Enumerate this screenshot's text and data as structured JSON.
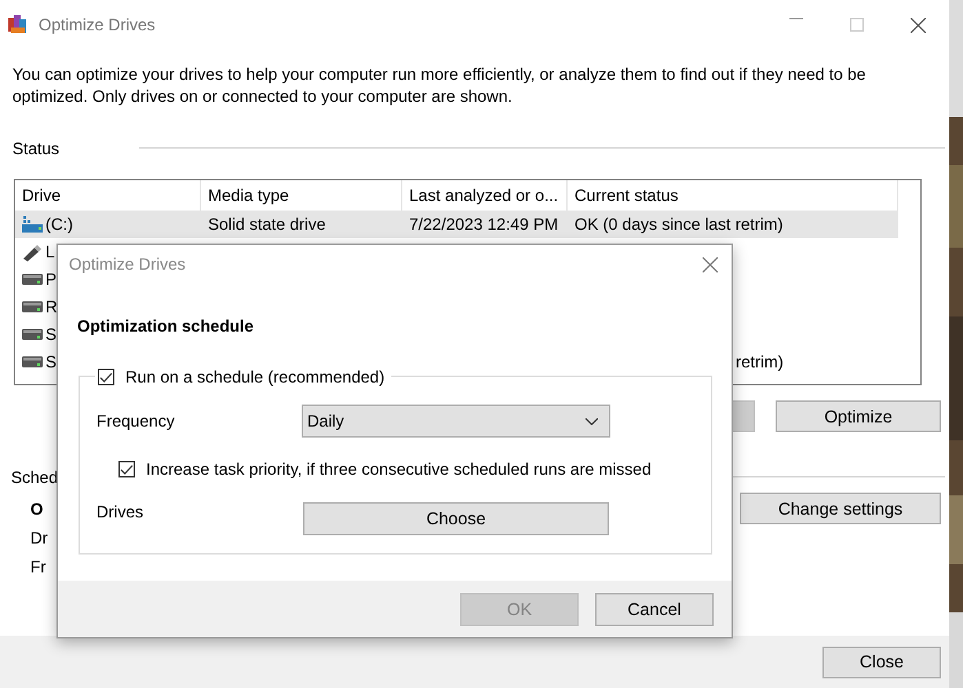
{
  "window": {
    "title": "Optimize Drives"
  },
  "description": "You can optimize your drives to help your computer run more efficiently, or analyze them to find out if they need to be optimized. Only drives on or connected to your computer are shown.",
  "status": {
    "label": "Status",
    "columns": [
      "Drive",
      "Media type",
      "Last analyzed or o...",
      "Current status"
    ],
    "rows": [
      {
        "kind": "ssd",
        "drive": "(C:)",
        "media_type": "Solid state drive",
        "last_analyzed": "7/22/2023 12:49 PM",
        "current_status": "OK (0 days since last retrim)",
        "selected": true
      },
      {
        "kind": "usb",
        "drive": "L",
        "selected": false
      },
      {
        "kind": "hdd",
        "drive": "P",
        "selected": false
      },
      {
        "kind": "hdd",
        "drive": "R",
        "selected": false
      },
      {
        "kind": "hdd",
        "drive": "S",
        "selected": false
      },
      {
        "kind": "hdd",
        "drive": "S",
        "current_status": "retrim)",
        "selected": false
      }
    ],
    "optimize_button": "Optimize"
  },
  "schedule": {
    "label": "Sched",
    "lines": [
      {
        "text": "O",
        "bold": true
      },
      {
        "text": "Dr",
        "bold": false
      },
      {
        "text": "Fr",
        "bold": false
      }
    ],
    "button": "Change settings"
  },
  "close_button": "Close",
  "dialog": {
    "title": "Optimize Drives",
    "heading": "Optimization schedule",
    "run_on_schedule": {
      "label": "Run on a schedule (recommended)",
      "checked": true
    },
    "frequency": {
      "label": "Frequency",
      "value": "Daily"
    },
    "increase_priority": {
      "label": "Increase task priority, if three consecutive scheduled runs are missed",
      "checked": true
    },
    "drives": {
      "label": "Drives",
      "button": "Choose"
    },
    "buttons": [
      {
        "label": "OK",
        "disabled": true
      },
      {
        "label": "Cancel",
        "disabled": false
      }
    ]
  }
}
